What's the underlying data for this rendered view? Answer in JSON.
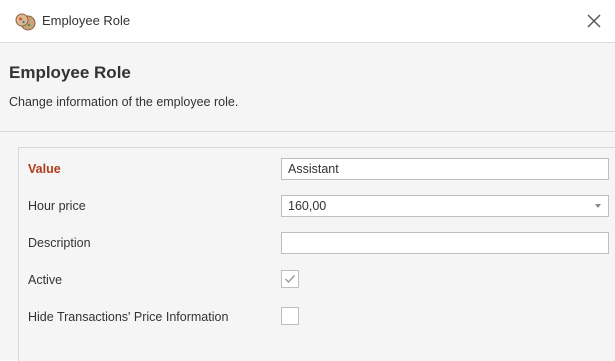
{
  "window": {
    "title": "Employee Role",
    "icon": "employee-role-app-icon",
    "close_icon": "close-icon"
  },
  "header": {
    "title": "Employee Role",
    "subtitle": "Change information of the employee role."
  },
  "form": {
    "value": {
      "label": "Value",
      "input_value": "Assistant",
      "required": true
    },
    "hour_price": {
      "label": "Hour price",
      "input_value": "160,00",
      "icon": "chevron-down-icon"
    },
    "description": {
      "label": "Description",
      "input_value": ""
    },
    "active": {
      "label": "Active",
      "checked": true
    },
    "hide_price_info": {
      "label": "Hide Transactions' Price Information",
      "checked": false
    }
  },
  "colors": {
    "required_label": "#b23a1a",
    "background": "#f5f5f5",
    "border": "#bfbfbf"
  }
}
